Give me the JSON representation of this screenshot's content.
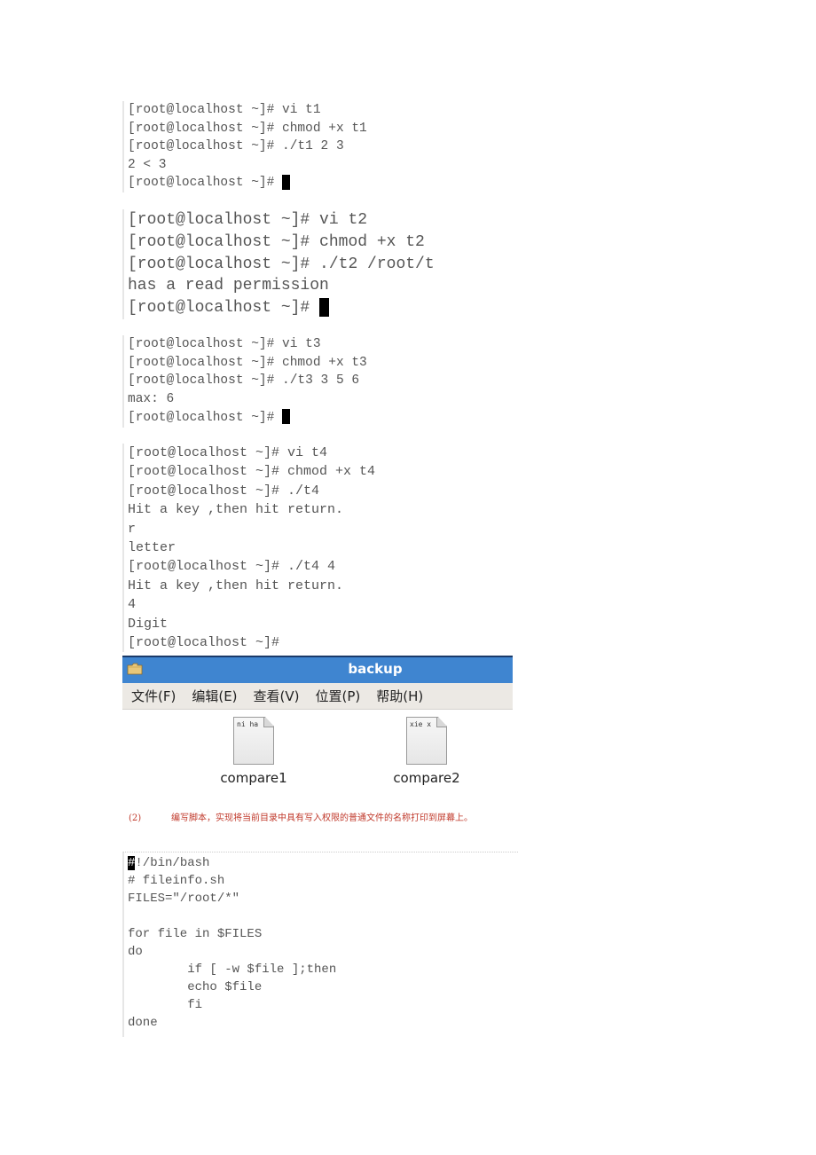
{
  "terminal_sessions": [
    {
      "id": "t1",
      "lines": [
        "[root@localhost ~]# vi t1",
        "[root@localhost ~]# chmod +x t1",
        "[root@localhost ~]# ./t1 2 3",
        "2 < 3",
        "[root@localhost ~]# "
      ],
      "cursor_after_last": true
    },
    {
      "id": "t2",
      "lines": [
        "[root@localhost ~]# vi t2",
        "[root@localhost ~]# chmod +x t2",
        "[root@localhost ~]# ./t2 /root/t",
        "has a read permission",
        "[root@localhost ~]# "
      ],
      "cursor_after_last": true
    },
    {
      "id": "t3",
      "lines": [
        "[root@localhost ~]# vi t3",
        "[root@localhost ~]# chmod +x t3",
        "[root@localhost ~]# ./t3 3 5 6",
        "max: 6",
        "[root@localhost ~]# "
      ],
      "cursor_after_last": true
    },
    {
      "id": "t4",
      "lines": [
        "[root@localhost ~]# vi t4",
        "[root@localhost ~]# chmod +x t4",
        "[root@localhost ~]# ./t4",
        "Hit a key ,then hit return.",
        "r",
        "letter",
        "[root@localhost ~]# ./t4 4",
        "Hit a key ,then hit return.",
        "4",
        "Digit",
        "[root@localhost ~]#"
      ],
      "cursor_after_last": false
    }
  ],
  "file_manager": {
    "title": "backup",
    "title_icon": "folder-icon",
    "title_bar_color": "#3f85d0",
    "menu": [
      "文件(F)",
      "编辑(E)",
      "查看(V)",
      "位置(P)",
      "帮助(H)"
    ],
    "files": [
      {
        "name": "compare1",
        "preview": "ni ha",
        "icon": "text-file-icon"
      },
      {
        "name": "compare2",
        "preview": "xie x",
        "icon": "text-file-icon"
      }
    ]
  },
  "task": {
    "number": "(2)",
    "text": "编写脚本，实现将当前目录中具有写入权限的普通文件的名称打印到屏幕上。",
    "color": "#c0392b"
  },
  "script": {
    "first_char": "#",
    "first_rest": "!/bin/bash",
    "lines": [
      "# fileinfo.sh",
      "FILES=\"/root/*\"",
      "",
      "for file in $FILES",
      "do",
      "        if [ -w $file ];then",
      "        echo $file",
      "        fi",
      "done"
    ]
  }
}
